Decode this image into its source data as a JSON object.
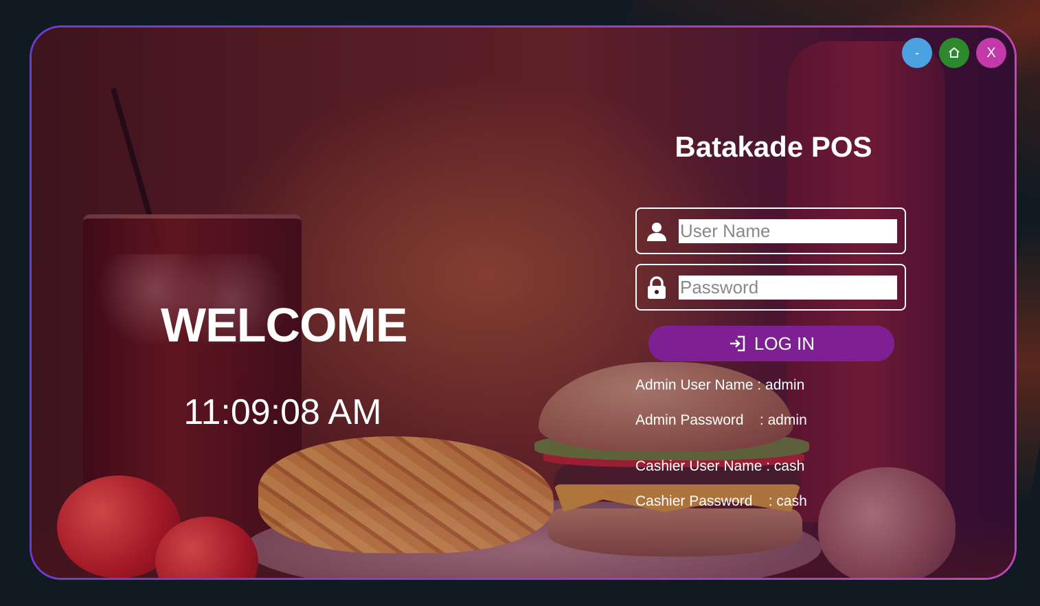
{
  "window": {
    "controls": {
      "minimize_label": "-",
      "home_icon": "home-icon",
      "close_label": "X"
    }
  },
  "left": {
    "welcome": "WELCOME",
    "clock": "11:09:08 AM"
  },
  "login": {
    "brand": "Batakade POS",
    "username_placeholder": "User Name",
    "password_placeholder": "Password",
    "login_label": "LOG IN",
    "user_icon": "user-icon",
    "lock_icon": "lock-icon",
    "login_icon": "sign-in-icon"
  },
  "hints": {
    "admin_user": "Admin User Name : admin",
    "admin_pass": "Admin Password    : admin",
    "cashier_user": "Cashier User Name : cash",
    "cashier_pass": "Cashier Password    : cash"
  },
  "colors": {
    "accent": "#7e1f94",
    "min_button": "#4aa3e0",
    "home_button": "#2c8a2c",
    "close_button": "#c23aa8",
    "frame_border": "#9b3fc8"
  }
}
